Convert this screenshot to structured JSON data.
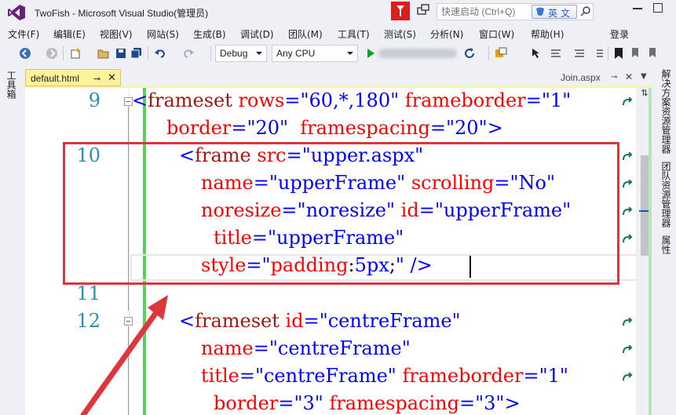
{
  "window": {
    "title": "TwoFish - Microsoft Visual Studio(管理员)"
  },
  "quick_launch": {
    "placeholder": "快速启动 (Ctrl+Q)",
    "ime_label": "英文"
  },
  "menu": {
    "items": [
      "文件(F)",
      "编辑(E)",
      "视图(V)",
      "网站(S)",
      "生成(B)",
      "调试(D)",
      "团队(M)",
      "工具(T)",
      "测试(S)",
      "分析(N)",
      "窗口(W)",
      "帮助(H)"
    ],
    "signin": "登录"
  },
  "toolbar": {
    "config_value": "Debug",
    "platform_value": "Any CPU"
  },
  "left_panel": {
    "toolbox_label": "工具箱"
  },
  "right_panel": {
    "solution_explorer": "解决方案资源管理器",
    "team_explorer": "团队资源管理器",
    "properties": "属性"
  },
  "tabs": {
    "active": "default.html",
    "other": "Join.aspx"
  },
  "editor": {
    "lines": [
      {
        "num": "9"
      },
      {
        "num": "10"
      },
      {
        "num": "11"
      },
      {
        "num": "12"
      }
    ],
    "l1": {
      "open": "<",
      "tag": "frameset",
      "a1": "rows",
      "v1": "\"60,*,180\"",
      "a2": "frameborder",
      "v2": "\"1\""
    },
    "l2": {
      "a1": "border",
      "v1": "\"20\"",
      "a2": "framespacing",
      "v2": "\"20\"",
      "close": ">"
    },
    "l3": {
      "open": "<",
      "tag": "frame",
      "a1": "src",
      "v1": "\"upper.aspx\""
    },
    "l4": {
      "a1": "name",
      "v1": "\"upperFrame\"",
      "a2": "scrolling",
      "v2": "\"No\""
    },
    "l5": {
      "a1": "noresize",
      "v1": "\"noresize\"",
      "a2": "id",
      "v2": "\"upperFrame\""
    },
    "l6": {
      "a1": "title",
      "v1": "\"upperFrame\""
    },
    "l7": {
      "a1": "style",
      "q1": "\"",
      "prop": "padding",
      "colon": ":",
      "num": "5px",
      "semi": ";",
      "q2": "\"",
      "close": " />"
    },
    "l9": {
      "open": "<",
      "tag": "frameset",
      "a1": "id",
      "v1": "\"centreFrame\""
    },
    "l10": {
      "a1": "name",
      "v1": "\"centreFrame\""
    },
    "l11": {
      "a1": "title",
      "v1": "\"centreFrame\"",
      "a2": "frameborder",
      "v2": "\"1\""
    },
    "l12": {
      "a1": "border",
      "v1": "\"3\"",
      "a2": "framespacing",
      "v2": "\"3\"",
      "close": ">"
    }
  },
  "colors": {
    "highlight_box": "#d9363e",
    "change_margin": "#5ad15a",
    "active_tab": "#fff29d"
  }
}
